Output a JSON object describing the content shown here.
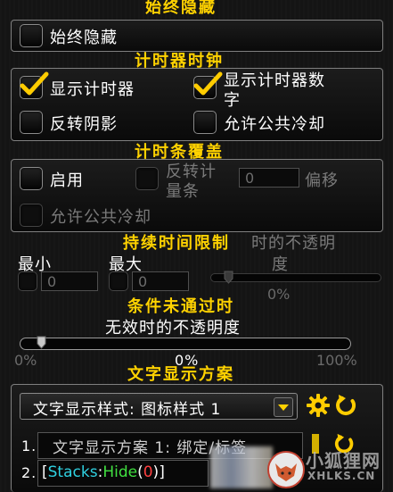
{
  "sections": {
    "hide": "始终隐藏",
    "timer": "计时器时钟",
    "overlay": "计时条覆盖",
    "duration": "持续时间限制",
    "condition": "条件未通过时",
    "text": "文字显示方案"
  },
  "checkboxes": {
    "always_hide": {
      "label": "始终隐藏",
      "checked": false
    },
    "show_timer": {
      "label": "显示计时器",
      "checked": true
    },
    "show_timer_number_1": "显示计时器数",
    "show_timer_number_2": "字",
    "show_timer_number_checked": true,
    "reverse_shadow": {
      "label": "反转阴影",
      "checked": false
    },
    "allow_gcd": {
      "label": "允许公共冷却",
      "checked": false
    },
    "enable": {
      "label": "启用",
      "checked": false
    },
    "reverse_bar_1": "反转计",
    "reverse_bar_2": "量条",
    "allow_gcd_2": {
      "label": "允许公共冷却",
      "checked": false
    }
  },
  "overlay": {
    "offset_value": "0",
    "offset_label": "偏移"
  },
  "duration": {
    "min_label": "最小",
    "max_label": "最大",
    "min_value": "0",
    "max_value": "0",
    "ghost_title": "时的不透明",
    "ghost_title_2": "度",
    "ghost_percent": "0%"
  },
  "condition": {
    "opacity_label": "无效时的不透明度",
    "min": "0%",
    "value": "0%",
    "max": "100%",
    "level": 0.05
  },
  "text_scheme": {
    "style_dropdown": "文字显示样式: 图标样式 1",
    "row1_index": "1.",
    "row1_text": "文字显示方案 1: 绑定/标签",
    "row2_index": "2.",
    "row2_open": "[",
    "row2_a": "Stacks",
    "row2_colon": ":",
    "row2_b": "Hide",
    "row2_paren_open": "(",
    "row2_num": "0",
    "row2_paren_close": ")",
    "row2_close": "]"
  },
  "watermark": {
    "line1": "小狐狸网",
    "line2": "XHLKS.CN"
  }
}
